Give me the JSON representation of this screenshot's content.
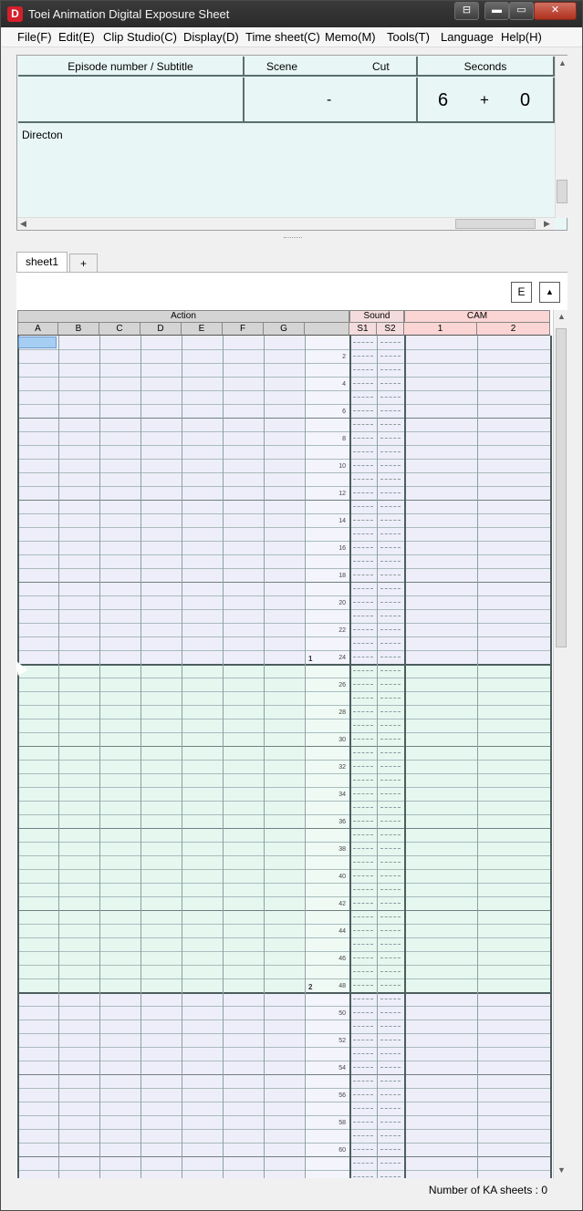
{
  "window": {
    "title": "Toei Animation Digital Exposure Sheet",
    "icon_letter": "D"
  },
  "titlebar_buttons": {
    "restore_small": "⊟",
    "minimize": "▬",
    "maximize": "▭",
    "close": "✕"
  },
  "menu": [
    "File(F)",
    "Edit(E)",
    "Clip Studio(C)",
    "Display(D)",
    "Time sheet(C)",
    "Memo(M)",
    "Tools(T)",
    "Language",
    "Help(H)"
  ],
  "header": {
    "episode_label": "Episode number / Subtitle",
    "scene_label": "Scene",
    "cut_label": "Cut",
    "seconds_label": "Seconds",
    "scene_cut_value": "-",
    "seconds_value": "6",
    "plus": "+",
    "frames_value": "0",
    "direction_label": "Directon"
  },
  "tabs": {
    "sheet1": "sheet1",
    "add": "+"
  },
  "toolbar": {
    "e_button": "E",
    "up_button": "▲"
  },
  "grid": {
    "action_header": "Action",
    "sound_header": "Sound",
    "cam_header": "CAM",
    "action_columns": [
      "A",
      "B",
      "C",
      "D",
      "E",
      "F",
      "G"
    ],
    "sound_columns": [
      "S1",
      "S2"
    ],
    "cam_columns": [
      "1",
      "2"
    ],
    "frame_numbers": [
      "2",
      "4",
      "6",
      "8",
      "10",
      "12",
      "14",
      "16",
      "18",
      "20",
      "22",
      "24",
      "26",
      "28",
      "30",
      "32",
      "34",
      "36",
      "38",
      "40",
      "42",
      "44",
      "46",
      "48",
      "50",
      "52",
      "54",
      "56",
      "58",
      "60"
    ],
    "sheet_markers": [
      "1",
      "2"
    ]
  },
  "colors": {
    "block_lavender": "#eeeefa",
    "block_mint": "#e6f7f0",
    "header_panel_bg": "#e8f7f5",
    "selection": "#a6cdf2"
  },
  "status": {
    "ka_sheets": "Number of KA sheets : 0"
  }
}
